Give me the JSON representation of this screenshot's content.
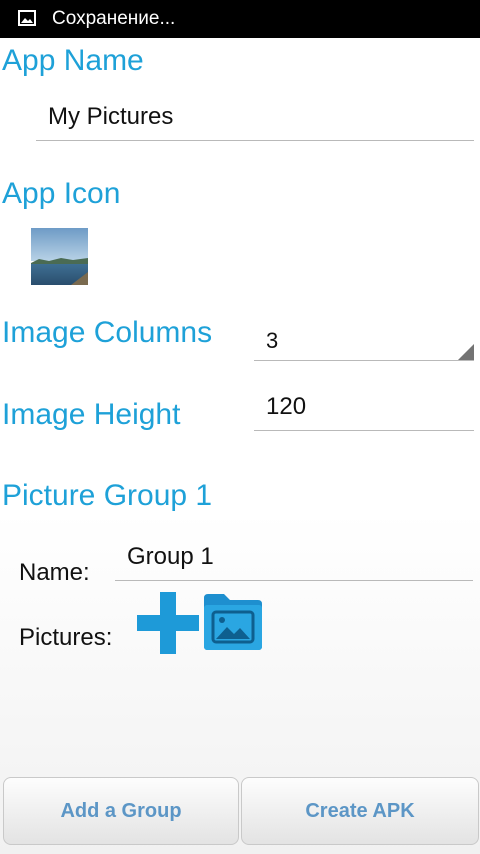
{
  "status_bar": {
    "title": "Сохранение..."
  },
  "app_name": {
    "heading": "App Name",
    "value": "My Pictures"
  },
  "app_icon": {
    "heading": "App Icon"
  },
  "image_columns": {
    "label": "Image Columns",
    "value": "3"
  },
  "image_height": {
    "label": "Image Height",
    "value": "120"
  },
  "picture_group": {
    "heading": "Picture Group 1",
    "name_label": "Name:",
    "name_value": "Group 1",
    "pictures_label": "Pictures:"
  },
  "buttons": {
    "add_group": "Add a Group",
    "create_apk": "Create APK"
  },
  "colors": {
    "accent": "#1ea1d8",
    "button_text": "#5c96c6",
    "icon_blue": "#1e9ad8"
  }
}
